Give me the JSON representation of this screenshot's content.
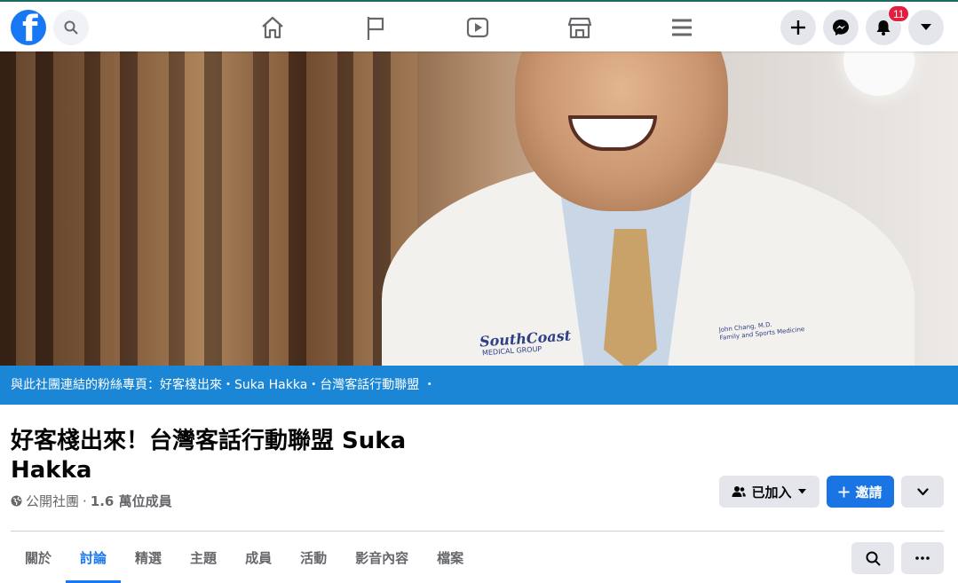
{
  "topnav": {
    "logo_icon": "facebook-logo",
    "search_icon": "search-icon",
    "center_icons": [
      "home-icon",
      "flag-icon",
      "video-icon",
      "marketplace-icon",
      "menu-icon"
    ],
    "right_icons": [
      "plus-icon",
      "messenger-icon",
      "notifications-icon",
      "caret-down-icon"
    ],
    "notification_count": "11"
  },
  "cover": {
    "clinic_logo": "SouthCoast",
    "clinic_logo_sub": "MEDICAL GROUP",
    "name_tag": "John Chang, M.D.",
    "name_tag_sub": "Family and Sports Medicine"
  },
  "linked_bar": {
    "text": "與此社團連結的粉絲專頁：好客棧出來・Suka Hakka・台灣客話行動聯盟 ・"
  },
  "group": {
    "title": "好客棧出來！台灣客話行動聯盟 Suka Hakka",
    "privacy": "公開社團",
    "separator": "·",
    "members": "1.6 萬位成員",
    "joined_label": "已加入",
    "invite_label": "邀請"
  },
  "tabs": [
    {
      "label": "關於",
      "active": false
    },
    {
      "label": "討論",
      "active": true
    },
    {
      "label": "精選",
      "active": false
    },
    {
      "label": "主題",
      "active": false
    },
    {
      "label": "成員",
      "active": false
    },
    {
      "label": "活動",
      "active": false
    },
    {
      "label": "影音內容",
      "active": false
    },
    {
      "label": "檔案",
      "active": false
    }
  ],
  "colors": {
    "brand": "#1877f2",
    "linked_bar": "#1b86d6",
    "badge": "#e41e3f"
  }
}
